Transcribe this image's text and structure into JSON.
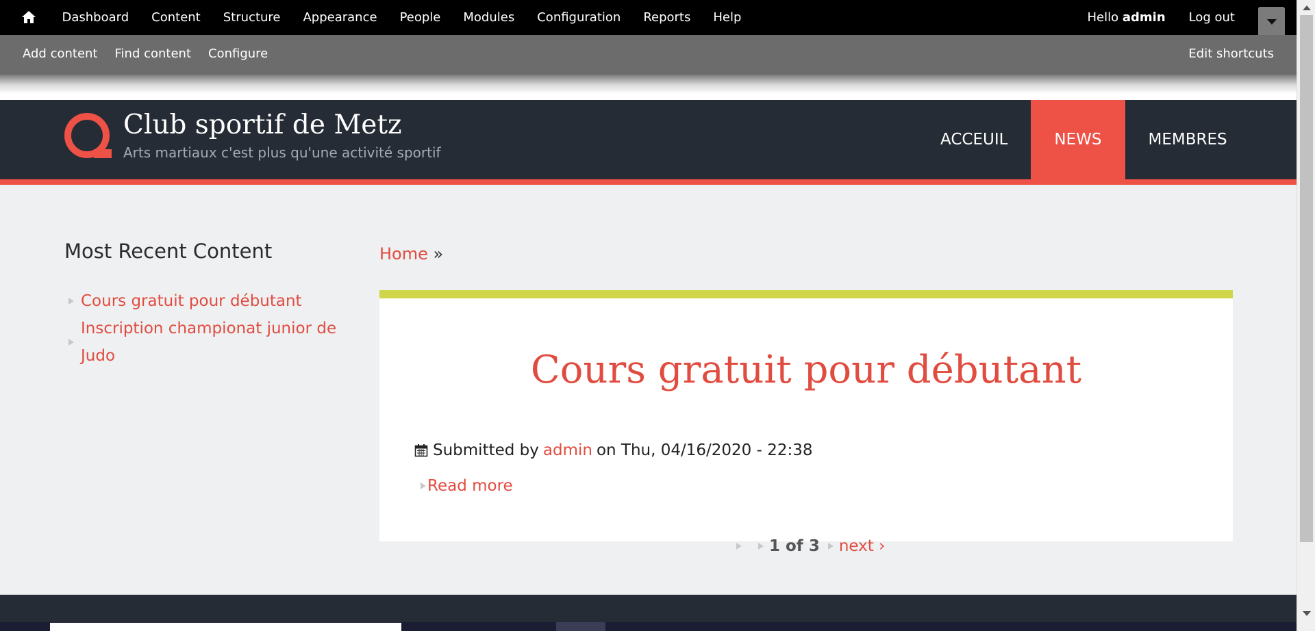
{
  "admin_toolbar": {
    "home_icon": "home-icon",
    "menu": [
      "Dashboard",
      "Content",
      "Structure",
      "Appearance",
      "People",
      "Modules",
      "Configuration",
      "Reports",
      "Help"
    ],
    "hello_prefix": "Hello",
    "user": "admin",
    "logout": "Log out",
    "toggle_icon": "caret-down-icon"
  },
  "shortcuts": {
    "items": [
      "Add content",
      "Find content",
      "Configure"
    ],
    "edit": "Edit shortcuts"
  },
  "site": {
    "name": "Club sportif de Metz",
    "slogan": "Arts martiaux c'est plus qu'une activité sportif",
    "nav": [
      {
        "label": "ACCEUIL",
        "active": false
      },
      {
        "label": "NEWS",
        "active": true
      },
      {
        "label": "MEMBRES",
        "active": false
      }
    ],
    "accent_color": "#ee5145",
    "header_color": "#262c35",
    "article_border_color": "#cfd64a"
  },
  "sidebar": {
    "title": "Most Recent Content",
    "items": [
      "Cours gratuit pour débutant",
      "Inscription championat junior de Judo"
    ]
  },
  "breadcrumb": {
    "home": "Home",
    "separator": "»"
  },
  "article": {
    "title": "Cours gratuit pour débutant",
    "submitted_by": "Submitted by",
    "author": "admin",
    "date": "on Thu, 04/16/2020 - 22:38",
    "read_more": "Read more"
  },
  "pager": {
    "current": "1 of 3",
    "next": "next ›"
  }
}
